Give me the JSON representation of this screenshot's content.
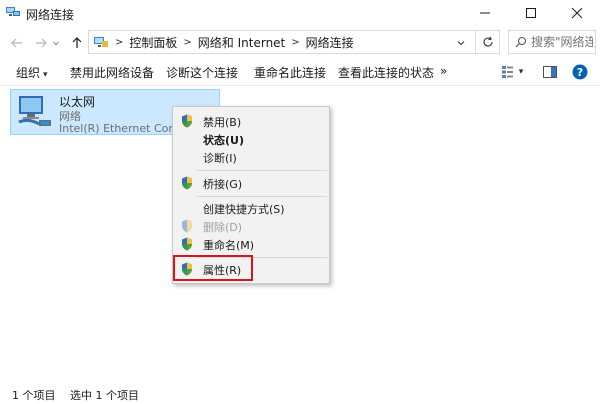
{
  "window": {
    "title": "网络连接"
  },
  "address": {
    "crumbs": [
      "控制面板",
      "网络和 Internet",
      "网络连接"
    ],
    "search_placeholder": "搜索\"网络连..."
  },
  "commands": {
    "organize": "组织",
    "disable": "禁用此网络设备",
    "diagnose": "诊断这个连接",
    "rename": "重命名此连接",
    "view_status": "查看此连接的状态",
    "more": "»"
  },
  "connection": {
    "name": "以太网",
    "type": "网络",
    "device": "Intel(R) Ethernet Conne..."
  },
  "context_menu": {
    "disable": "禁用(B)",
    "status": "状态(U)",
    "diagnose": "诊断(I)",
    "bridge": "桥接(G)",
    "shortcut": "创建快捷方式(S)",
    "delete": "删除(D)",
    "rename": "重命名(M)",
    "properties": "属性(R)"
  },
  "status": {
    "count": "1 个项目",
    "selected": "选中 1 个项目"
  },
  "colors": {
    "highlight_box": "#d9141c",
    "selection_bg": "#cce8ff",
    "help_blue": "#0063b1"
  }
}
